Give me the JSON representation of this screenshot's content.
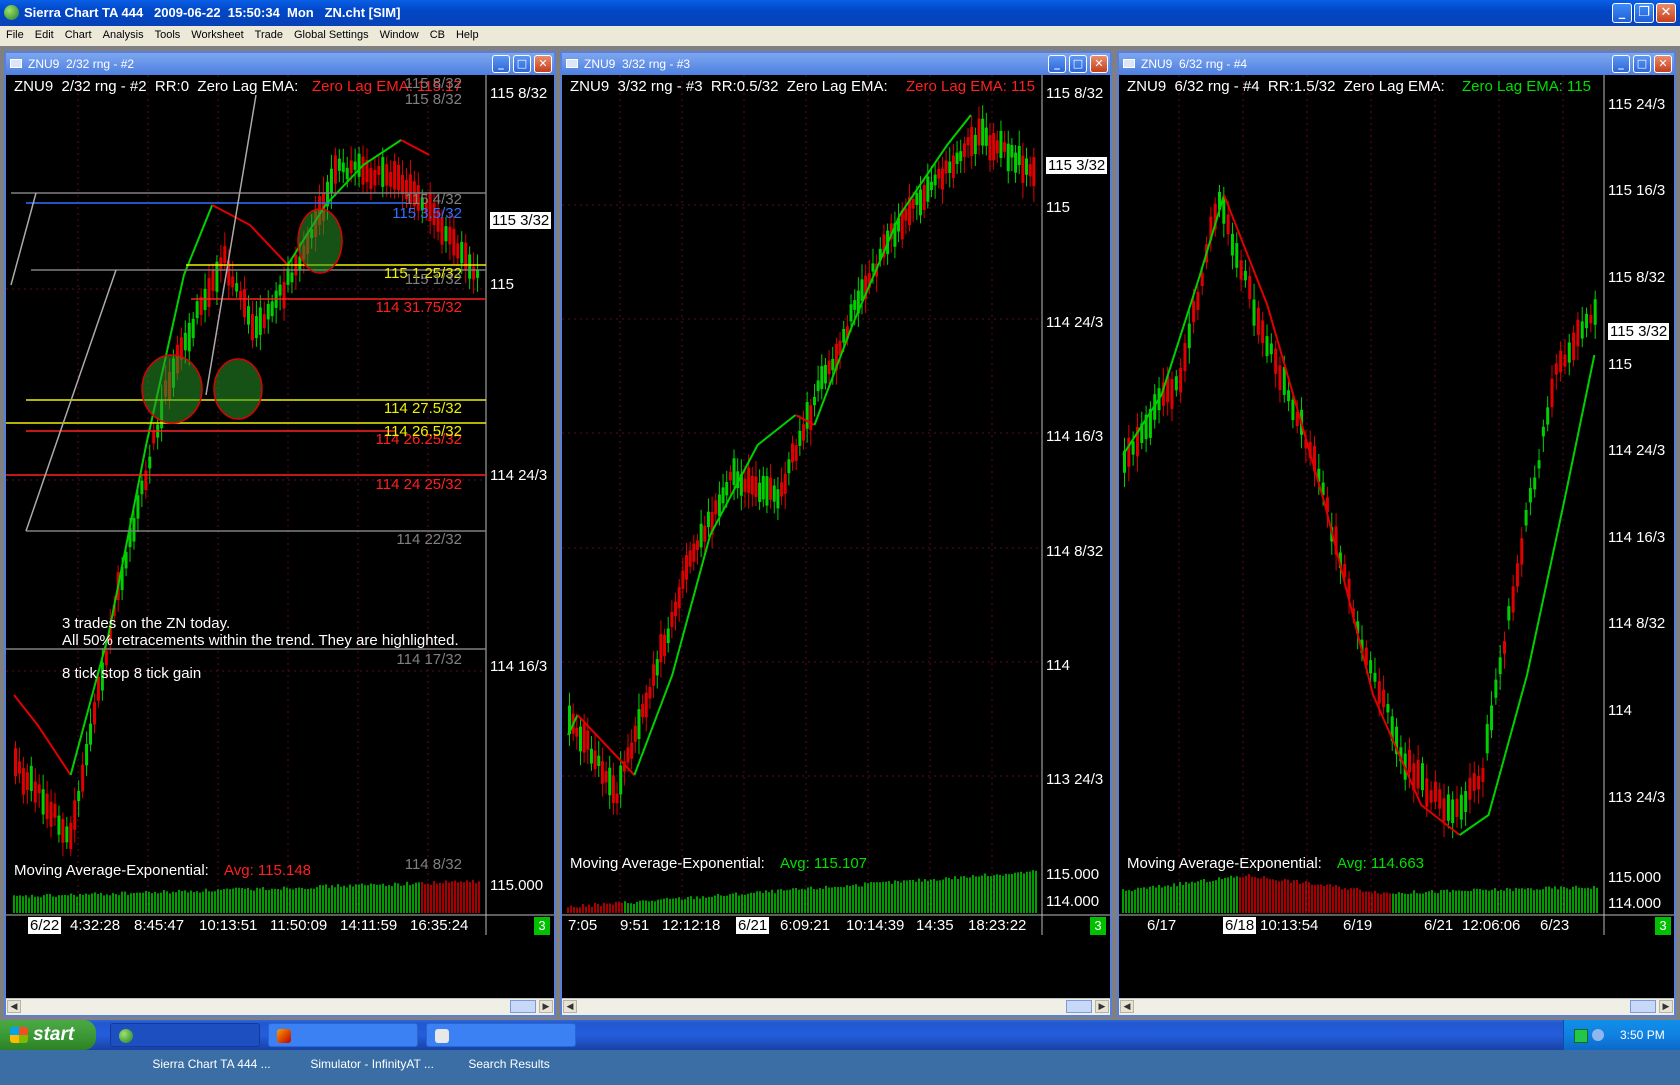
{
  "app": {
    "title": "Sierra Chart TA 444   2009-06-22  15:50:34  Mon   ZN.cht [SIM]",
    "window_buttons": [
      "_",
      "❐",
      "✕"
    ]
  },
  "menu": [
    "File",
    "Edit",
    "Chart",
    "Analysis",
    "Tools",
    "Worksheet",
    "Trade",
    "Global Settings",
    "Window",
    "CB",
    "Help"
  ],
  "charts": [
    {
      "title": "ZNU9  2/32 rng - #2",
      "header": "ZNU9  2/32 rng - #2  RR:0  Zero Lag EMA:",
      "header_value": "Zero Lag EMA: 115.17",
      "header_value_color": "#ff2020",
      "y_ticks": [
        "115 8/32",
        "115",
        "114 24/3",
        "114 16/3",
        "115.000"
      ],
      "current_price": "115 3/32",
      "price_levels": [
        {
          "text": "115 8/32",
          "color": "#808080"
        },
        {
          "text": "115 4/32",
          "color": "#808080"
        },
        {
          "text": "115 3.5/32",
          "color": "#3070ff"
        },
        {
          "text": "115 1.25/32",
          "color": "#f0f000"
        },
        {
          "text": "115 1/32",
          "color": "#808080"
        },
        {
          "text": "114 31.75/32",
          "color": "#ff2020"
        },
        {
          "text": "114 27.5/32",
          "color": "#f0f000"
        },
        {
          "text": "114 26.5/32",
          "color": "#f0f000"
        },
        {
          "text": "114 26.25/32",
          "color": "#ff2020"
        },
        {
          "text": "114 24 25/32",
          "color": "#ff2020"
        },
        {
          "text": "114 22/32",
          "color": "#808080"
        },
        {
          "text": "114 17/32",
          "color": "#808080"
        },
        {
          "text": "114 8/32",
          "color": "#808080"
        }
      ],
      "notes": [
        "3 trades on the ZN today.",
        "All 50% retracements within the trend. They are highlighted.",
        "8 tick stop 8 tick gain"
      ],
      "ma_label": "Moving Average-Exponential:",
      "ma_value": "Avg: 115.148",
      "ma_value_color": "#ff2020",
      "x_labels": [
        "6/22",
        "4:32:28",
        "8:45:47",
        "10:13:51",
        "11:50:09",
        "14:11:59",
        "16:35:24"
      ],
      "badge": "3"
    },
    {
      "title": "ZNU9  3/32 rng - #3",
      "header": "ZNU9  3/32 rng - #3  RR:0.5/32  Zero Lag EMA:",
      "header_value": "Zero Lag EMA: 115",
      "header_value_color": "#ff2020",
      "y_ticks": [
        "115 8/32",
        "115",
        "114 24/3",
        "114 16/3",
        "114 8/32",
        "114",
        "113 24/3",
        "115.000",
        "114.000"
      ],
      "current_price": "115 3/32",
      "ma_label": "Moving Average-Exponential:",
      "ma_value": "Avg: 115.107",
      "ma_value_color": "#00e000",
      "x_labels": [
        "7:05",
        "9:51",
        "12:12:18",
        "6/21",
        "6:09:21",
        "10:14:39",
        "14:35",
        "18:23:22"
      ],
      "badge": "3"
    },
    {
      "title": "ZNU9  6/32 rng - #4",
      "header": "ZNU9  6/32 rng - #4  RR:1.5/32  Zero Lag EMA:",
      "header_value": "Zero Lag EMA: 115",
      "header_value_color": "#00e000",
      "y_ticks": [
        "115 24/3",
        "115 16/3",
        "115 8/32",
        "115",
        "114 24/3",
        "114 16/3",
        "114 8/32",
        "114",
        "113 24/3",
        "115.000",
        "114.000"
      ],
      "current_price": "115 3/32",
      "ma_label": "Moving Average-Exponential:",
      "ma_value": "Avg: 114.663",
      "ma_value_color": "#00e000",
      "x_labels": [
        "6/17",
        "6/18",
        "10:13:54",
        "6/19",
        "6/21",
        "12:06:06",
        "6/23"
      ],
      "badge": "3"
    }
  ],
  "taskbar": {
    "start": "start",
    "tasks": [
      "Sierra Chart TA 444 ...",
      "Simulator - InfinityAT ...",
      "Search Results"
    ],
    "clock": "3:50 PM"
  }
}
